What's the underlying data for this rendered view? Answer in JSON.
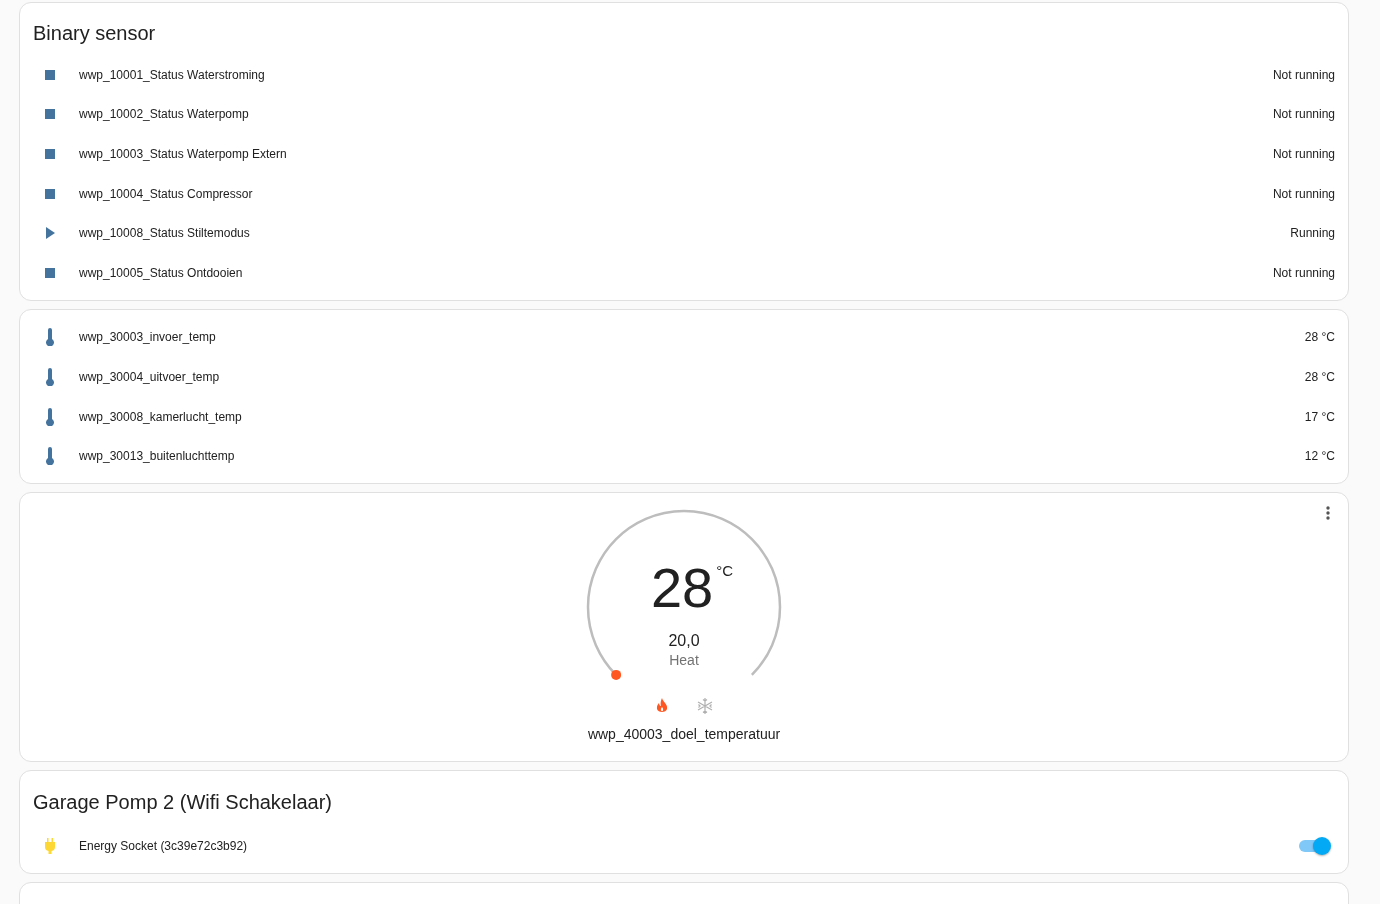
{
  "binary_card": {
    "title": "Binary sensor",
    "rows": [
      {
        "name": "wwp_10001_Status Waterstroming",
        "state": "Not running",
        "on": false
      },
      {
        "name": "wwp_10002_Status Waterpomp",
        "state": "Not running",
        "on": false
      },
      {
        "name": "wwp_10003_Status Waterpomp Extern",
        "state": "Not running",
        "on": false
      },
      {
        "name": "wwp_10004_Status Compressor",
        "state": "Not running",
        "on": false
      },
      {
        "name": "wwp_10008_Status Stiltemodus",
        "state": "Running",
        "on": true
      },
      {
        "name": "wwp_10005_Status Ontdooien",
        "state": "Not running",
        "on": false
      }
    ]
  },
  "temperature_card": {
    "rows": [
      {
        "name": "wwp_30003_invoer_temp",
        "value": "28 °C"
      },
      {
        "name": "wwp_30004_uitvoer_temp",
        "value": "28 °C"
      },
      {
        "name": "wwp_30008_kamerlucht_temp",
        "value": "17 °C"
      },
      {
        "name": "wwp_30013_buitenluchttemp",
        "value": "12 °C"
      }
    ]
  },
  "thermostat_card": {
    "current": "28",
    "unit": "°C",
    "target": "20,0",
    "mode_label": "Heat",
    "modes": [
      {
        "kind": "heat",
        "selected": true
      },
      {
        "kind": "cool",
        "selected": false
      }
    ],
    "name": "wwp_40003_doel_temperatuur"
  },
  "switch_card": {
    "title": "Garage Pomp 2 (Wifi Schakelaar)",
    "rows": [
      {
        "name": "Energy Socket (3c39e72c3b92)",
        "on": true
      }
    ]
  }
}
